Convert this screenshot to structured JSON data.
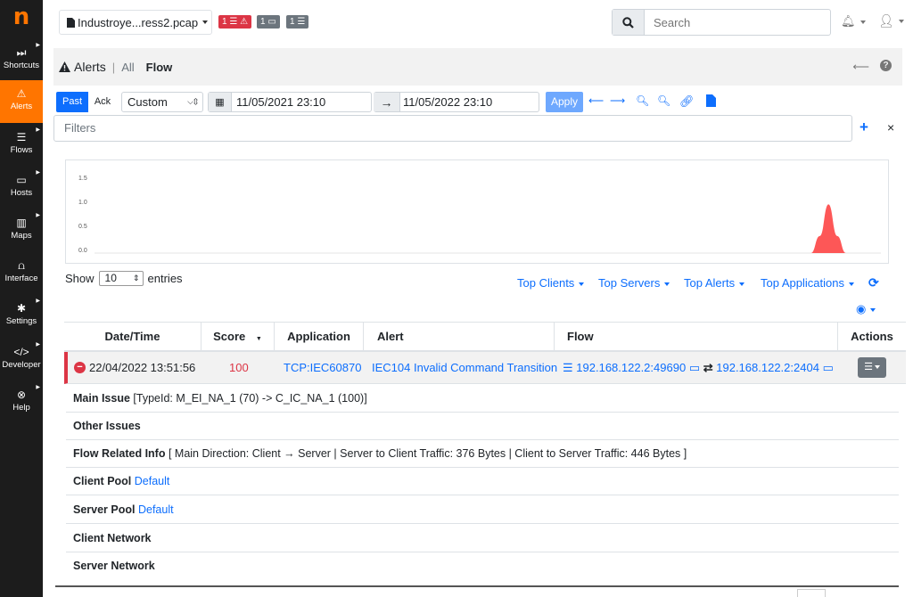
{
  "sidebar": {
    "logo": "n",
    "items": [
      {
        "label": "Shortcuts",
        "icon": "fast-forward-icon",
        "glyph": "⏭"
      },
      {
        "label": "Alerts",
        "icon": "warning-icon",
        "glyph": "⚠"
      },
      {
        "label": "Flows",
        "icon": "list-icon",
        "glyph": "☰"
      },
      {
        "label": "Hosts",
        "icon": "laptop-icon",
        "glyph": "▭"
      },
      {
        "label": "Maps",
        "icon": "map-icon",
        "glyph": "▥"
      },
      {
        "label": "Interface",
        "icon": "ethernet-icon",
        "glyph": "⩍"
      },
      {
        "label": "Settings",
        "icon": "gear-icon",
        "glyph": "✱"
      },
      {
        "label": "Developer",
        "icon": "code-icon",
        "glyph": "</>"
      },
      {
        "label": "Help",
        "icon": "lifebuoy-icon",
        "glyph": "⊗"
      }
    ]
  },
  "topbar": {
    "interface_name": "Industroye...ress2.pcap",
    "badges": [
      {
        "text": "1 ☰ ⚠",
        "color": "#dc3545"
      },
      {
        "text": "1 ▭",
        "color": "#6c757d"
      },
      {
        "text": "1 ☰",
        "color": "#6c757d"
      }
    ],
    "search_placeholder": "Search"
  },
  "page": {
    "title": "Alerts",
    "separator": "|",
    "crumb_all": "All",
    "crumb_active": "Flow"
  },
  "controls": {
    "past": "Past",
    "ack": "Ack",
    "range_select": "Custom",
    "begin": "11/05/2021 23:10",
    "end": "11/05/2022 23:10",
    "apply": "Apply",
    "arrow_sep": "→"
  },
  "filters": {
    "placeholder": "Filters"
  },
  "chart_data": {
    "type": "area",
    "y_ticks": [
      "1.5",
      "1.0",
      "0.5",
      "0.0"
    ],
    "ylim": [
      0,
      1.5
    ],
    "series": [
      {
        "values": [
          0,
          0,
          0,
          0,
          0,
          0,
          0,
          0,
          0,
          0,
          0,
          0,
          0,
          0,
          0,
          0,
          0,
          0,
          0,
          0,
          0,
          0,
          0,
          0,
          0,
          0,
          0,
          0,
          0,
          0,
          0,
          0,
          0,
          0,
          0,
          0,
          0,
          0,
          0,
          0,
          0,
          0,
          0,
          0,
          0,
          0,
          0,
          0,
          0,
          0,
          0,
          0,
          0,
          0,
          0,
          0,
          0,
          0,
          0,
          0,
          0,
          0,
          0,
          0,
          0,
          0,
          0,
          0,
          0,
          0,
          0,
          0,
          0,
          0,
          0,
          0,
          0,
          0,
          0,
          0,
          0,
          0,
          0,
          0.35,
          1.0,
          0.35,
          0,
          0,
          0,
          0,
          0
        ]
      }
    ],
    "color": "#fd5757"
  },
  "table_controls": {
    "show": "Show",
    "entries_value": "10",
    "entries": "entries",
    "top_clients": "Top Clients",
    "top_servers": "Top Servers",
    "top_alerts": "Top Alerts",
    "top_applications": "Top Applications"
  },
  "table": {
    "headers": [
      "Date/Time",
      "Score",
      "Application",
      "Alert",
      "Flow",
      "Actions"
    ],
    "row": {
      "datetime": "22/04/2022 13:51:56",
      "score": "100",
      "application": "TCP:IEC60870",
      "alert": "IEC104 Invalid Command Transition",
      "flow_client": "192.168.122.2:49690",
      "flow_server": "192.168.122.2:2404"
    },
    "details": [
      {
        "label": "Main Issue",
        "value": " [TypeId: M_EI_NA_1 (70) -> C_IC_NA_1 (100)]",
        "link": ""
      },
      {
        "label": "Other Issues",
        "value": "",
        "link": ""
      },
      {
        "label": "Flow Related Info",
        "value": " [ Main Direction: Client → Server | Server to Client Traffic: 376 Bytes | Client to Server Traffic: 446 Bytes ]",
        "link": ""
      },
      {
        "label": "Client Pool",
        "value": "",
        "link": "Default"
      },
      {
        "label": "Server Pool",
        "value": "",
        "link": "Default"
      },
      {
        "label": "Client Network",
        "value": "",
        "link": ""
      },
      {
        "label": "Server Network",
        "value": "",
        "link": ""
      }
    ]
  }
}
